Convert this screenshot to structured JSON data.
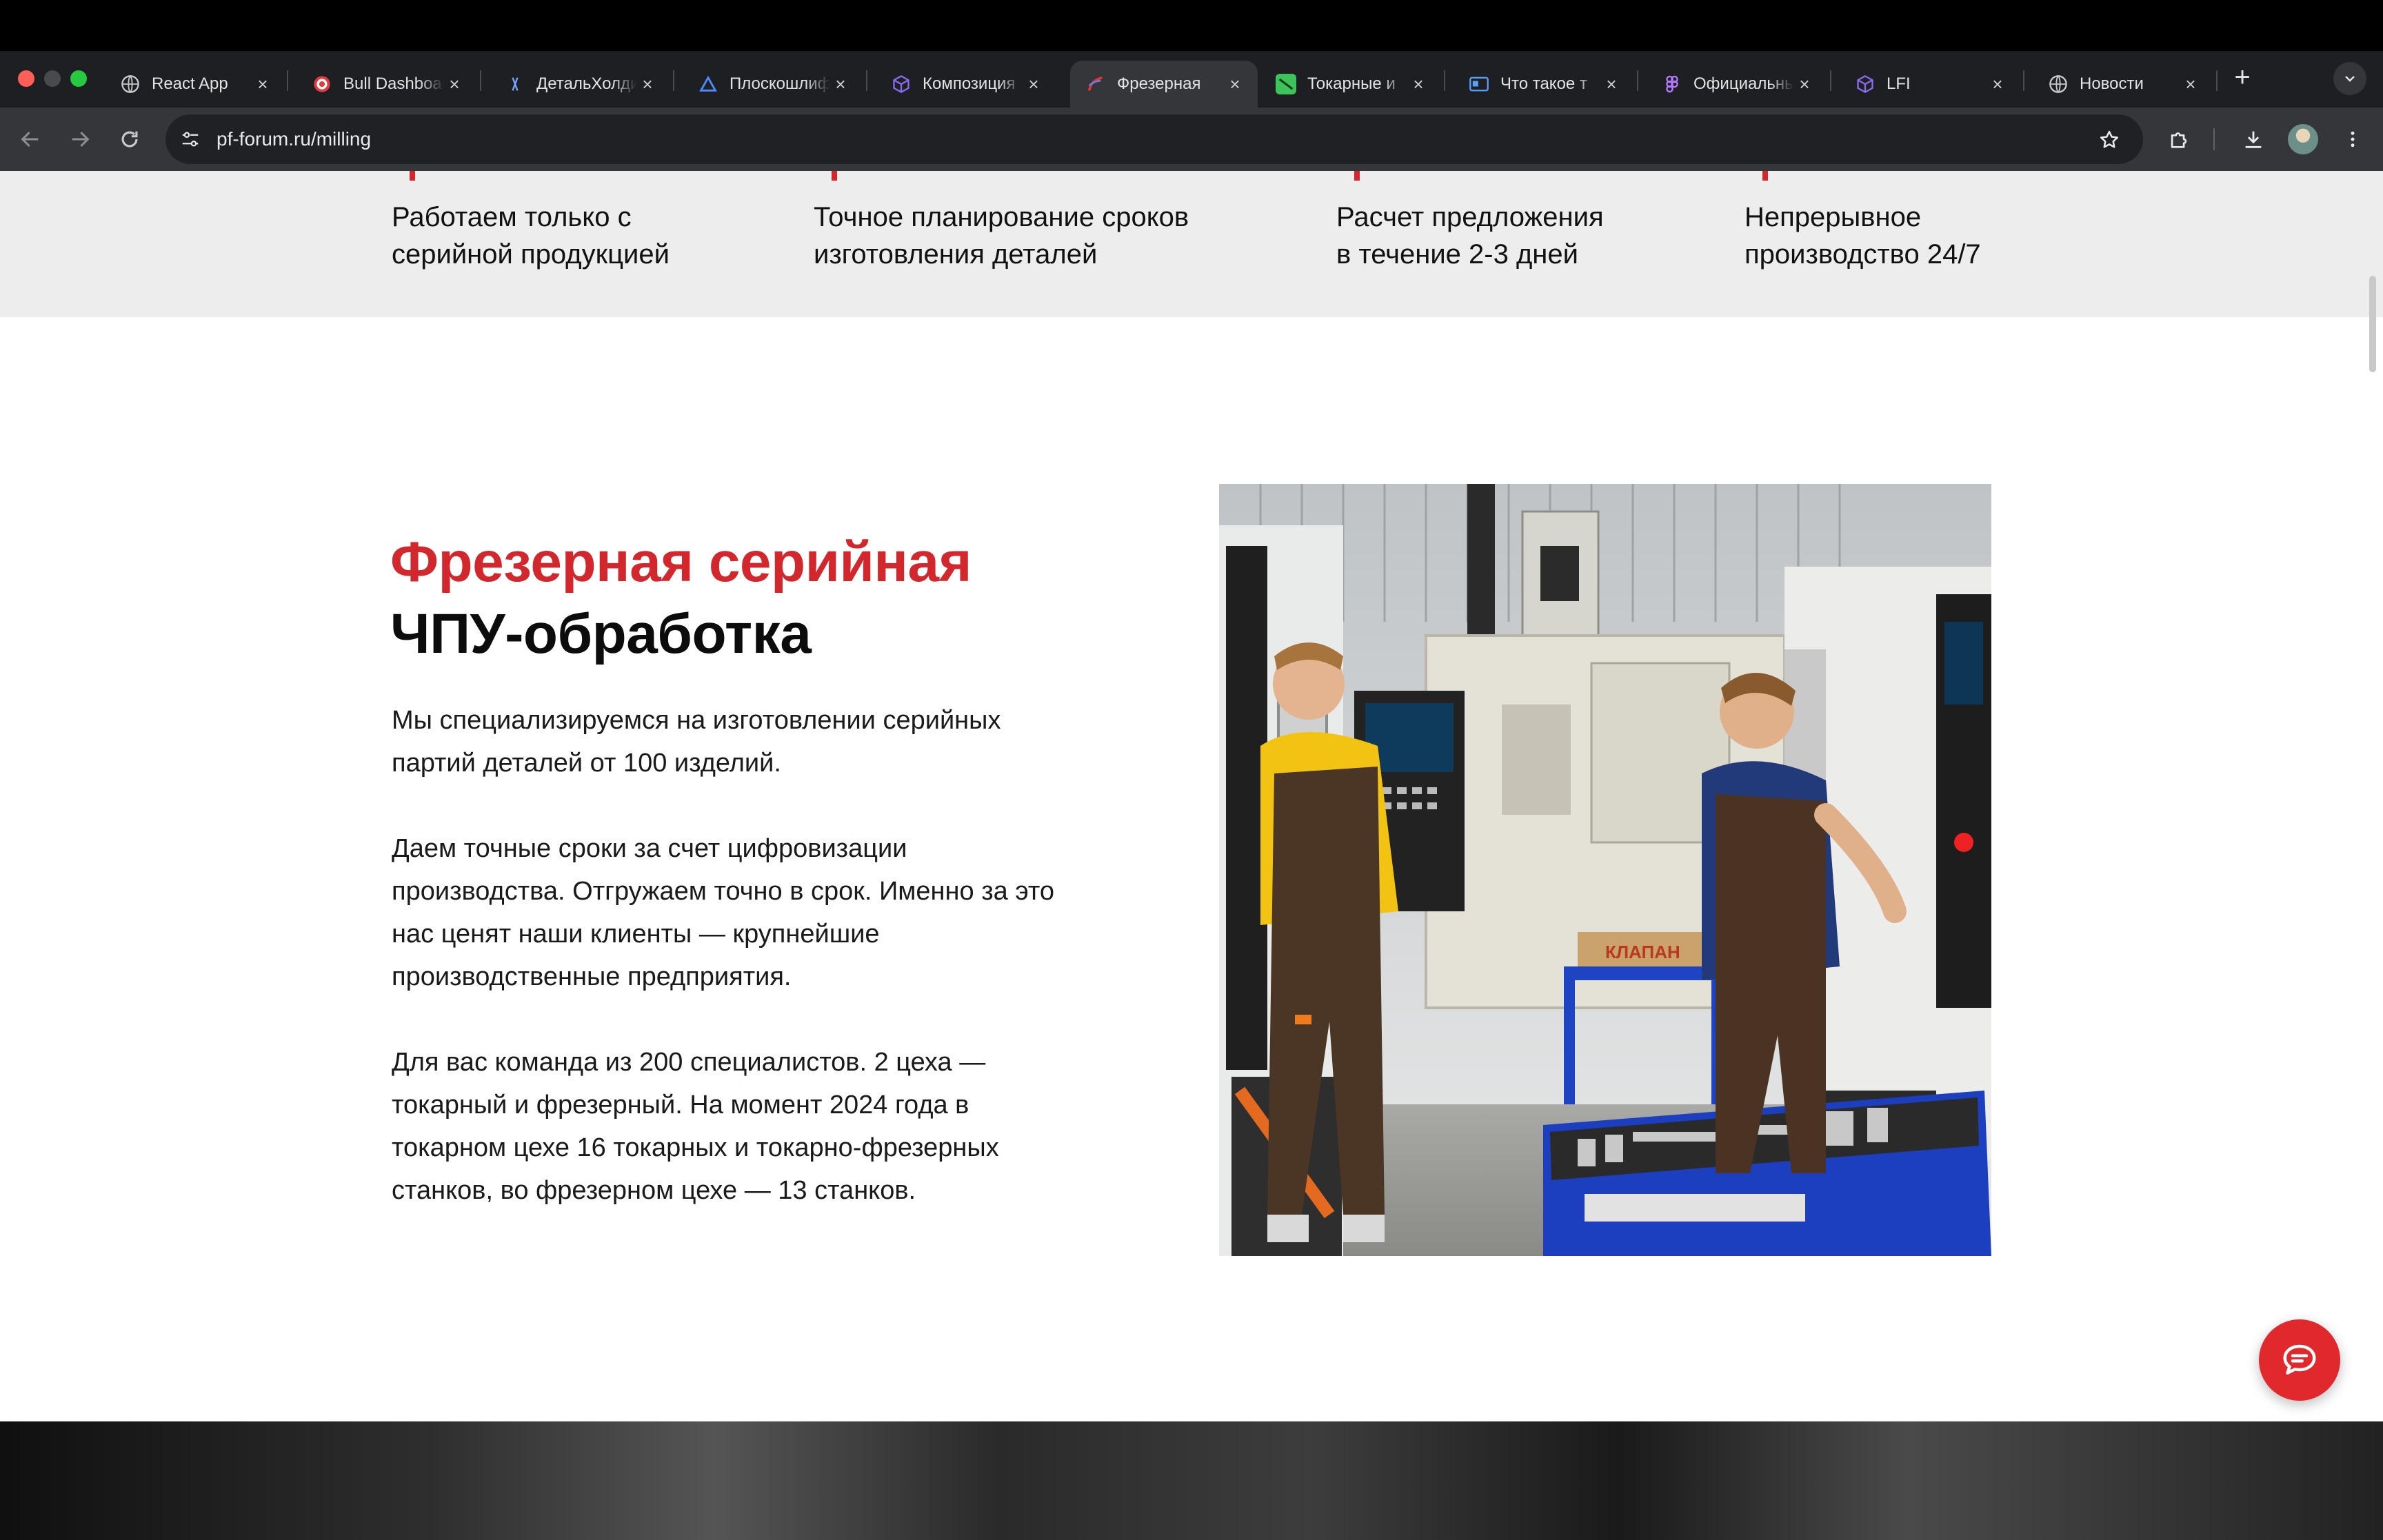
{
  "browser": {
    "tabs": [
      {
        "title": "React App",
        "icon": "globe-icon",
        "active": false
      },
      {
        "title": "Bull Dashboard",
        "icon": "target-icon",
        "active": false
      },
      {
        "title": "ДетальХолдинг",
        "icon": "detal-icon",
        "active": false
      },
      {
        "title": "Плоскошлифовальные",
        "icon": "triangle-icon",
        "active": false
      },
      {
        "title": "Композиция",
        "icon": "cube-icon",
        "active": false
      },
      {
        "title": "Фрезерная",
        "icon": "mill-icon",
        "active": true
      },
      {
        "title": "Токарные и",
        "icon": "lathe-icon",
        "active": false
      },
      {
        "title": "Что такое т",
        "icon": "card-icon",
        "active": false
      },
      {
        "title": "Официальный",
        "icon": "figma-icon",
        "active": false
      },
      {
        "title": "LFI",
        "icon": "cube-icon",
        "active": false
      },
      {
        "title": "Новости",
        "icon": "globe-icon",
        "active": false
      }
    ],
    "url": {
      "domain": "pf-forum.ru",
      "path": "/milling"
    }
  },
  "benefits": [
    {
      "line1": "Работаем только с",
      "line2": "серийной продукцией"
    },
    {
      "line1": "Точное планирование сроков",
      "line2": "изготовления деталей"
    },
    {
      "line1": "Расчет предложения",
      "line2": "в течение 2-3 дней"
    },
    {
      "line1": "Непрерывное",
      "line2": "производство 24/7"
    }
  ],
  "section": {
    "title_red": "Фрезерная серийная",
    "title_black": "ЧПУ-обработка",
    "paragraphs": [
      "Мы специализируемся на изготовлении серийных партий деталей от 100 изделий.",
      "Даем точные сроки за счет цифровизации производства. Отгружаем точно в срок. Именно за это нас ценят наши клиенты — крупнейшие производственные предприятия.",
      "Для вас команда из 200 специалистов. 2 цеха — токарный и фрезерный. На момент 2024 года в токарном цехе 16 токарных и токарно-фрезерных станков, во фрезерном цехе — 13 станков."
    ],
    "photo_box_label": "КЛАПАН"
  },
  "colors": {
    "accent": "#d2282d",
    "chat_button": "#e0282d",
    "benefits_bg": "#ededed"
  }
}
